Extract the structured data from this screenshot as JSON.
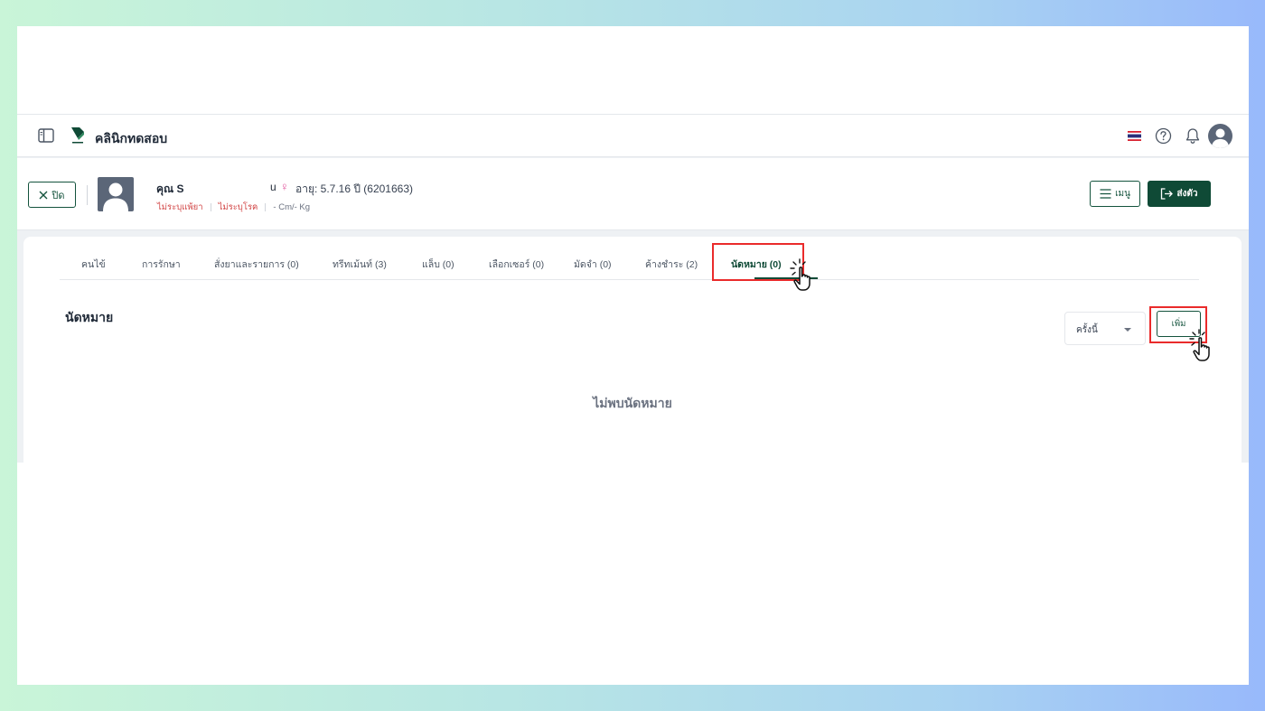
{
  "header": {
    "clinic_name": "คลินิกทดสอบ"
  },
  "patient": {
    "close_label": "ปิด",
    "name_prefix": "คุณ S",
    "name_tail": "u",
    "age": "อายุ: 5.7.16 ปี  (6201663)",
    "drug_allergy": "ไม่ระบุแพ้ยา",
    "disease": "ไม่ระบุโรค",
    "body": "- Cm/- Kg",
    "menu_label": "เมนู",
    "send_label": "ส่งตัว"
  },
  "tabs": [
    {
      "label": "คนไข้"
    },
    {
      "label": "การรักษา"
    },
    {
      "label": "สั่งยาและรายการ (0)"
    },
    {
      "label": "ทรีทเม้นท์ (3)"
    },
    {
      "label": "แล็บ (0)"
    },
    {
      "label": "เลือกเซอร์ (0)"
    },
    {
      "label": "มัดจำ (0)"
    },
    {
      "label": "ค้างชำระ (2)"
    },
    {
      "label": "นัดหมาย (0)",
      "active": true
    }
  ],
  "appointments": {
    "title": "นัดหมาย",
    "period_value": "ครั้งนี้",
    "add_label": "เพิ่ม",
    "empty_message": "ไม่พบนัดหมาย"
  },
  "colors": {
    "brand": "#0f4a36",
    "highlight": "#ea2b2b",
    "female": "#e0529b",
    "tag_red": "#d14343"
  }
}
